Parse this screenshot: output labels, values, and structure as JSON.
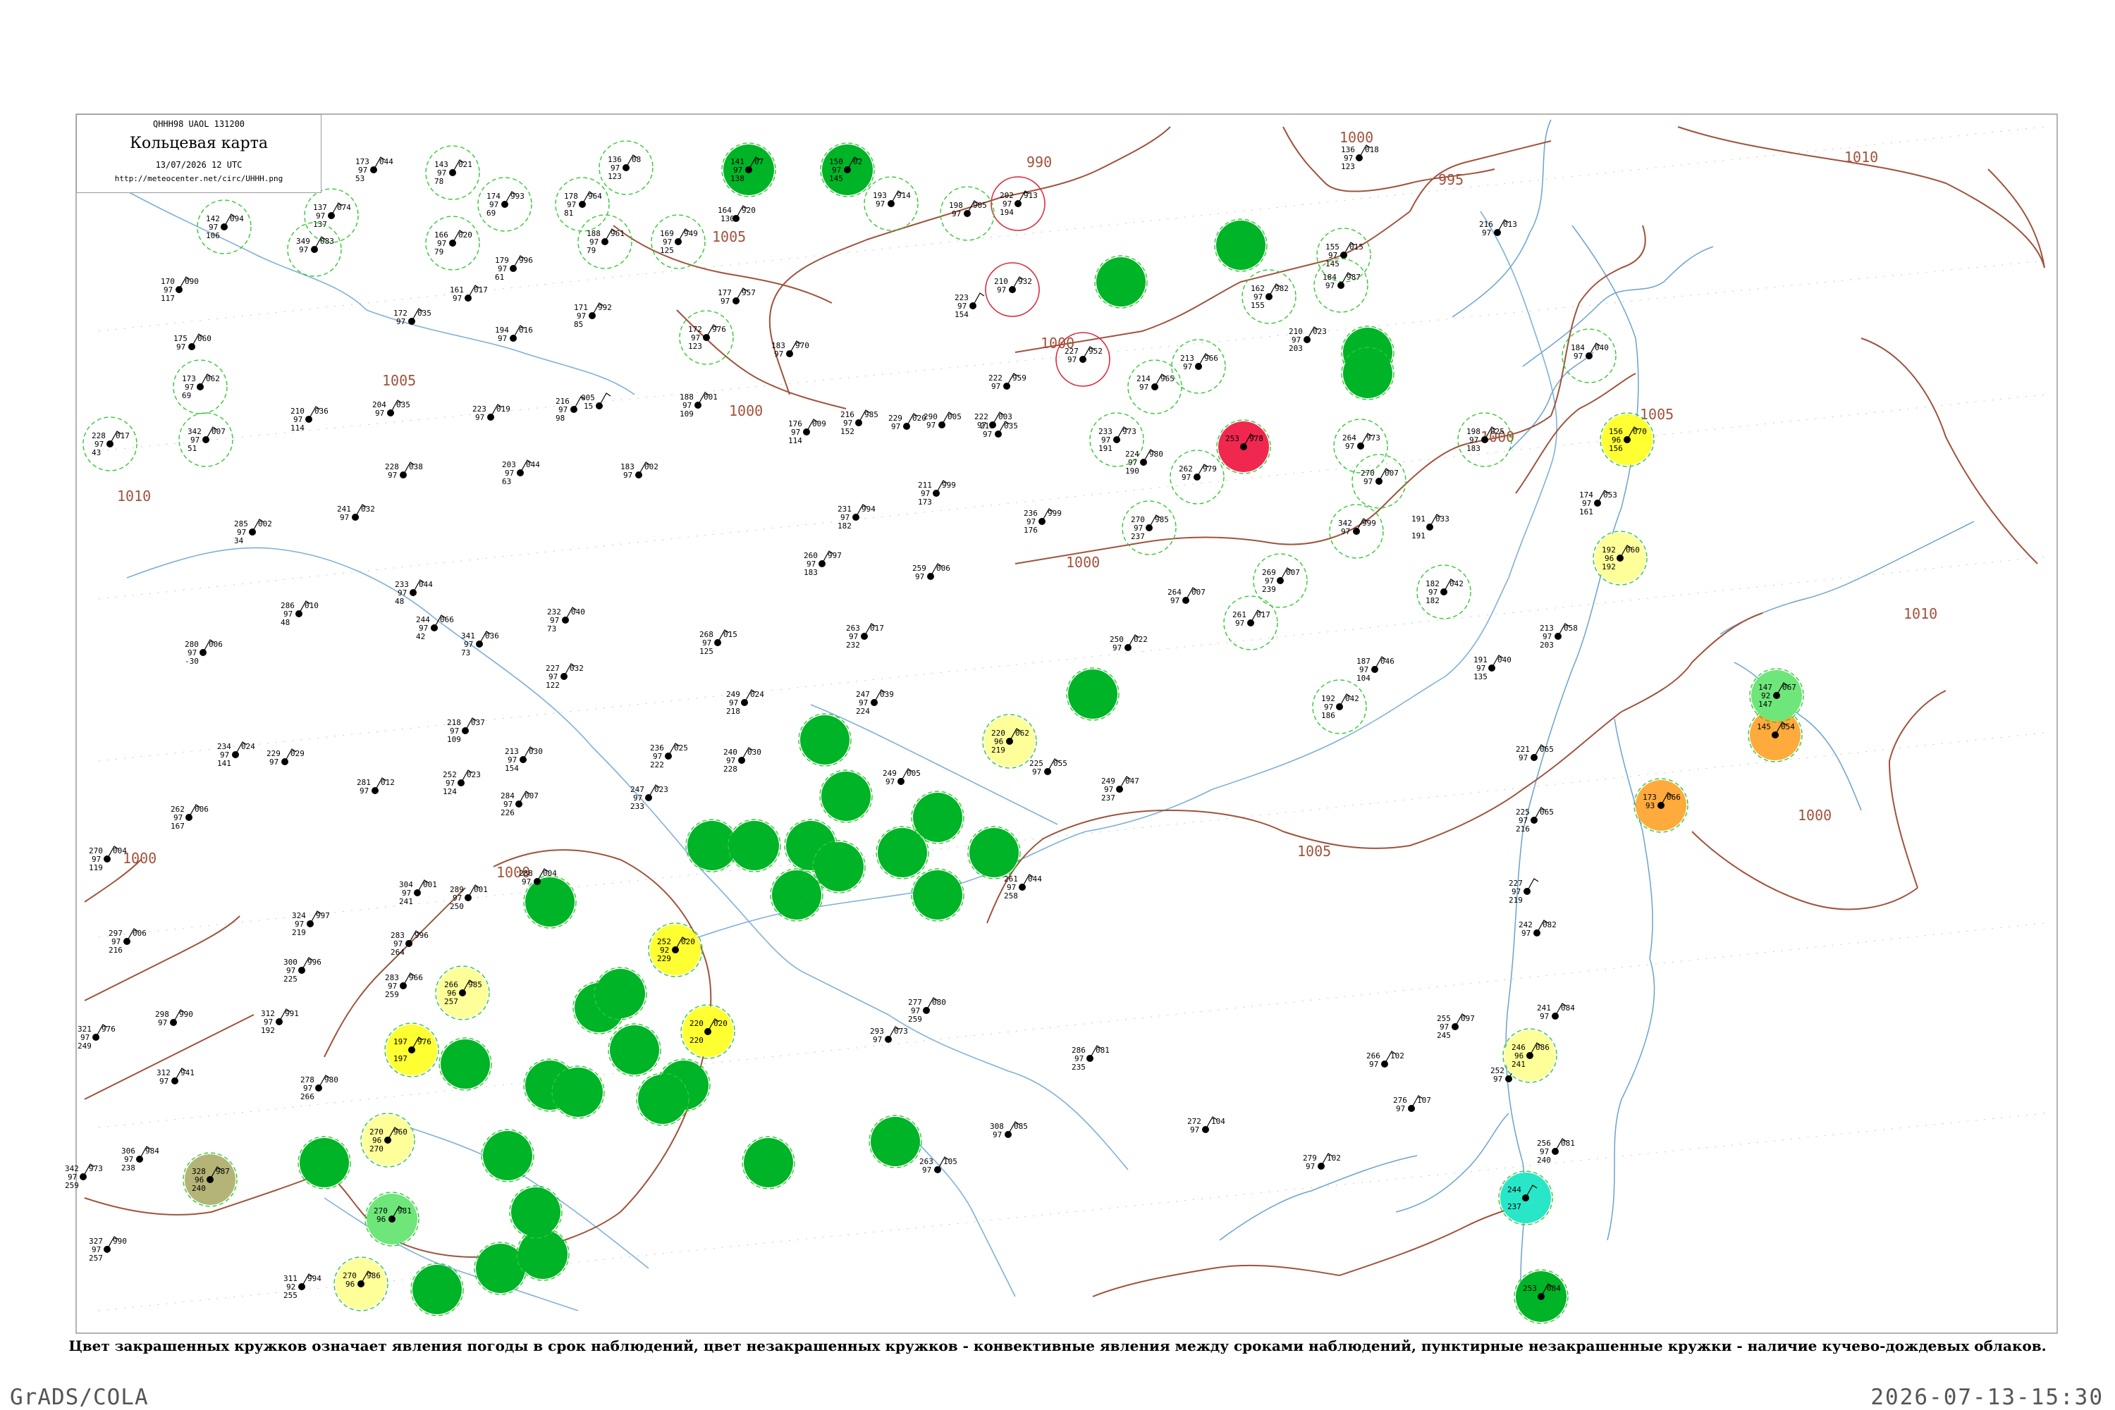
{
  "header": {
    "code": "QHHH98  UAOL  131200",
    "title": "Кольцевая карта",
    "date": "13/07/2026 12 UTC",
    "url": "http://meteocenter.net/circ/UHHH.png"
  },
  "isobars": [
    "1010",
    "1000",
    "995",
    "990",
    "1005",
    "1000",
    "1005",
    "1000",
    "1000",
    "1005",
    "1010",
    "1000",
    "1010",
    "1010",
    "1000",
    "1000",
    "1005",
    "1000"
  ],
  "colors": {
    "isobar": "#a0523c",
    "river": "#7fb0d8",
    "coast": "#6aa2cf",
    "grid": "#c8c8c8",
    "green": "#00b428",
    "light_green": "#6ee67a",
    "yellow": "#ffff32",
    "light_yellow": "#ffff9a",
    "orange": "#ffaa3c",
    "red": "#f02850",
    "olive": "#b4b478",
    "cyan": "#28e6c8",
    "dash_ring": "#32c832",
    "red_ring": "#dc283c"
  },
  "stations": [
    {
      "id": "33",
      "a": "",
      "b": "",
      "c": "",
      "d": ""
    },
    {
      "id": "34",
      "a": "141",
      "b": "97",
      "c": "138",
      "d": "07"
    },
    {
      "id": "35",
      "a": "150",
      "b": "97",
      "c": "145",
      "d": "02"
    },
    {
      "id": "36",
      "a": "136",
      "b": "97",
      "c": "123",
      "d": "08"
    },
    {
      "id": "37",
      "a": "173",
      "b": "97",
      "c": "53",
      "d": "044"
    },
    {
      "id": "38",
      "a": "143",
      "b": "97",
      "c": "78",
      "d": "021"
    },
    {
      "id": "39",
      "a": "137",
      "b": "97",
      "c": "137",
      "d": "074"
    },
    {
      "id": "40",
      "a": "142",
      "b": "97",
      "c": "106",
      "d": "094"
    },
    {
      "id": "41",
      "a": "178",
      "b": "97",
      "c": "81",
      "d": "964"
    },
    {
      "id": "42",
      "a": "174",
      "b": "97",
      "c": "69",
      "d": "993"
    },
    {
      "id": "43",
      "a": "166",
      "b": "97",
      "c": "79",
      "d": "020"
    },
    {
      "id": "44",
      "a": "188",
      "b": "97",
      "c": "79",
      "d": "961"
    },
    {
      "id": "45",
      "a": "169",
      "b": "97",
      "c": "125",
      "d": "949"
    },
    {
      "id": "46",
      "a": "349",
      "b": "97",
      "c": "",
      "d": "083"
    },
    {
      "id": "47",
      "a": "170",
      "b": "97",
      "c": "117",
      "d": "090"
    },
    {
      "id": "48",
      "a": "179",
      "b": "97",
      "c": "61",
      "d": "996"
    },
    {
      "id": "49",
      "a": "161",
      "b": "97",
      "c": "",
      "d": "017"
    },
    {
      "id": "50",
      "a": "171",
      "b": "97",
      "c": "85",
      "d": "992"
    },
    {
      "id": "51",
      "a": "177",
      "b": "97",
      "c": "",
      "d": "957"
    },
    {
      "id": "52",
      "a": "172",
      "b": "97",
      "c": "123",
      "d": "976"
    },
    {
      "id": "53",
      "a": "194",
      "b": "97",
      "c": "",
      "d": "016"
    },
    {
      "id": "54",
      "a": "172",
      "b": "97",
      "c": "",
      "d": "035"
    },
    {
      "id": "55",
      "a": "175",
      "b": "97",
      "c": "",
      "d": "060"
    },
    {
      "id": "56",
      "a": "173",
      "b": "97",
      "c": "69",
      "d": "062"
    },
    {
      "id": "57",
      "a": "183",
      "b": "97",
      "c": "",
      "d": "970"
    },
    {
      "id": "58",
      "a": "223",
      "b": "97",
      "c": "",
      "d": "019"
    },
    {
      "id": "59",
      "a": "204",
      "b": "97",
      "c": "",
      "d": "035"
    },
    {
      "id": "60",
      "a": "216",
      "b": "97",
      "c": "98",
      "d": ""
    },
    {
      "id": "61",
      "a": "005",
      "b": "15",
      "c": "",
      "d": ""
    },
    {
      "id": "62",
      "a": "188",
      "b": "97",
      "c": "109",
      "d": "001"
    },
    {
      "id": "63",
      "a": "210",
      "b": "97",
      "c": "114",
      "d": "036"
    },
    {
      "id": "64",
      "a": "228",
      "b": "97",
      "c": "43",
      "d": "017"
    },
    {
      "id": "65",
      "a": "342",
      "b": "97",
      "c": "51",
      "d": "007"
    },
    {
      "id": "66",
      "a": "228",
      "b": "97",
      "c": "",
      "d": "038"
    },
    {
      "id": "67",
      "a": "203",
      "b": "97",
      "c": "63",
      "d": "044"
    },
    {
      "id": "68",
      "a": "183",
      "b": "97",
      "c": "",
      "d": "002"
    },
    {
      "id": "69",
      "a": "241",
      "b": "97",
      "c": "",
      "d": "032"
    },
    {
      "id": "70",
      "a": "285",
      "b": "97",
      "c": "34",
      "d": "002"
    },
    {
      "id": "71",
      "a": "233",
      "b": "97",
      "c": "48",
      "d": "044"
    },
    {
      "id": "72",
      "a": "286",
      "b": "97",
      "c": "48",
      "d": "010"
    },
    {
      "id": "73",
      "a": "244",
      "b": "97",
      "c": "42",
      "d": "066"
    },
    {
      "id": "74",
      "a": "232",
      "b": "97",
      "c": "73",
      "d": "040"
    },
    {
      "id": "75",
      "a": "280",
      "b": "97",
      "c": "-30",
      "d": "006"
    },
    {
      "id": "76",
      "a": "341",
      "b": "97",
      "c": "73",
      "d": "036"
    },
    {
      "id": "77",
      "a": "227",
      "b": "97",
      "c": "122",
      "d": "032"
    },
    {
      "id": "78",
      "a": "268",
      "b": "97",
      "c": "125",
      "d": "015"
    },
    {
      "id": "79",
      "a": "249",
      "b": "97",
      "c": "218",
      "d": "024"
    },
    {
      "id": "80",
      "a": "247",
      "b": "97",
      "c": "224",
      "d": "039"
    },
    {
      "id": "81",
      "a": "263",
      "b": "97",
      "c": "232",
      "d": "017"
    },
    {
      "id": "82",
      "a": "259",
      "b": "97",
      "c": "",
      "d": "006"
    },
    {
      "id": "83",
      "a": "260",
      "b": "97",
      "c": "183",
      "d": "997"
    },
    {
      "id": "84",
      "a": "231",
      "b": "97",
      "c": "182",
      "d": "994"
    },
    {
      "id": "85",
      "a": "211",
      "b": "97",
      "c": "173",
      "d": "999"
    },
    {
      "id": "86",
      "a": "236",
      "b": "97",
      "c": "176",
      "d": "999"
    },
    {
      "id": "87",
      "a": "264",
      "b": "97",
      "c": "",
      "d": "007"
    },
    {
      "id": "88",
      "a": "261",
      "b": "97",
      "c": "",
      "d": "017"
    },
    {
      "id": "89",
      "a": "250",
      "b": "97",
      "c": "",
      "d": "022"
    },
    {
      "id": "90",
      "a": "216",
      "b": "97",
      "c": "152",
      "d": "985"
    },
    {
      "id": "91",
      "a": "176",
      "b": "97",
      "c": "114",
      "d": "009"
    },
    {
      "id": "92",
      "a": "229",
      "b": "97",
      "c": "",
      "d": "020"
    },
    {
      "id": "93",
      "a": "216",
      "b": "97",
      "c": "",
      "d": "035"
    },
    {
      "id": "94",
      "a": "218",
      "b": "97",
      "c": "109",
      "d": "037"
    },
    {
      "id": "95",
      "a": "234",
      "b": "97",
      "c": "141",
      "d": "024"
    },
    {
      "id": "96",
      "a": "229",
      "b": "97",
      "c": "",
      "d": "029"
    },
    {
      "id": "97",
      "a": "262",
      "b": "97",
      "c": "167",
      "d": "006"
    },
    {
      "id": "98",
      "a": "270",
      "b": "97",
      "c": "119",
      "d": "004"
    },
    {
      "id": "99",
      "a": "281",
      "b": "97",
      "c": "",
      "d": "012"
    },
    {
      "id": "100",
      "a": "213",
      "b": "97",
      "c": "154",
      "d": "030"
    },
    {
      "id": "101",
      "a": "252",
      "b": "97",
      "c": "124",
      "d": "023"
    },
    {
      "id": "102",
      "a": "284",
      "b": "97",
      "c": "226",
      "d": "007"
    },
    {
      "id": "103",
      "a": "236",
      "b": "97",
      "c": "222",
      "d": "025"
    },
    {
      "id": "104",
      "a": "240",
      "b": "97",
      "c": "228",
      "d": "030"
    },
    {
      "id": "105",
      "a": "247",
      "b": "97",
      "c": "233",
      "d": "023"
    },
    {
      "id": "106",
      "a": "249",
      "b": "97",
      "c": "",
      "d": "005"
    },
    {
      "id": "107",
      "a": "288",
      "b": "97",
      "c": "",
      "d": "004"
    },
    {
      "id": "108",
      "a": "304",
      "b": "97",
      "c": "241",
      "d": "001"
    },
    {
      "id": "109",
      "a": "289",
      "b": "97",
      "c": "250",
      "d": "001"
    },
    {
      "id": "110",
      "a": "324",
      "b": "97",
      "c": "219",
      "d": "997"
    },
    {
      "id": "111",
      "a": "283",
      "b": "97",
      "c": "264",
      "d": "996"
    },
    {
      "id": "112",
      "a": "300",
      "b": "97",
      "c": "225",
      "d": "996"
    },
    {
      "id": "113",
      "a": "283",
      "b": "97",
      "c": "259",
      "d": "966"
    },
    {
      "id": "114",
      "a": "297",
      "b": "97",
      "c": "216",
      "d": "006"
    },
    {
      "id": "115",
      "a": "298",
      "b": "97",
      "c": "",
      "d": "990"
    },
    {
      "id": "116",
      "a": "312",
      "b": "97",
      "c": "192",
      "d": "991"
    },
    {
      "id": "117",
      "a": "321",
      "b": "97",
      "c": "249",
      "d": "976"
    },
    {
      "id": "118",
      "a": "312",
      "b": "97",
      "c": "",
      "d": "941"
    },
    {
      "id": "119",
      "a": "306",
      "b": "97",
      "c": "238",
      "d": "984"
    },
    {
      "id": "120",
      "a": "342",
      "b": "97",
      "c": "259",
      "d": "973"
    },
    {
      "id": "121",
      "a": "327",
      "b": "97",
      "c": "257",
      "d": "990"
    },
    {
      "id": "122",
      "a": "311",
      "b": "92",
      "c": "255",
      "d": "994"
    },
    {
      "id": "123",
      "a": "278",
      "b": "97",
      "c": "266",
      "d": "980"
    },
    {
      "id": "124",
      "a": "277",
      "b": "97",
      "c": "259",
      "d": "080"
    },
    {
      "id": "125",
      "a": "293",
      "b": "97",
      "c": "",
      "d": "073"
    },
    {
      "id": "126",
      "a": "286",
      "b": "97",
      "c": "235",
      "d": "081"
    },
    {
      "id": "127",
      "a": "308",
      "b": "97",
      "c": "",
      "d": "085"
    },
    {
      "id": "128",
      "a": "263",
      "b": "97",
      "c": "",
      "d": "105"
    },
    {
      "id": "129",
      "a": "272",
      "b": "97",
      "c": "",
      "d": "104"
    },
    {
      "id": "130",
      "a": "279",
      "b": "97",
      "c": "",
      "d": "102"
    },
    {
      "id": "131",
      "a": "266",
      "b": "97",
      "c": "",
      "d": "102"
    },
    {
      "id": "132",
      "a": "276",
      "b": "97",
      "c": "",
      "d": "107"
    },
    {
      "id": "133",
      "a": "255",
      "b": "97",
      "c": "245",
      "d": "097"
    },
    {
      "id": "134",
      "a": "252",
      "b": "97",
      "c": "",
      "d": "077"
    },
    {
      "id": "135",
      "a": "256",
      "b": "97",
      "c": "240",
      "d": "081"
    },
    {
      "id": "136",
      "a": "241",
      "b": "97",
      "c": "",
      "d": "084"
    },
    {
      "id": "137",
      "a": "227",
      "b": "97",
      "c": "219",
      "d": ""
    },
    {
      "id": "138",
      "a": "242",
      "b": "97",
      "c": "",
      "d": "082"
    },
    {
      "id": "139",
      "a": "221",
      "b": "97",
      "c": "",
      "d": "065"
    },
    {
      "id": "140",
      "a": "225",
      "b": "97",
      "c": "216",
      "d": "065"
    },
    {
      "id": "141",
      "a": "213",
      "b": "97",
      "c": "203",
      "d": "058"
    },
    {
      "id": "142",
      "a": "191",
      "b": "97",
      "c": "135",
      "d": "040"
    },
    {
      "id": "143",
      "a": "187",
      "b": "97",
      "c": "104",
      "d": "046"
    },
    {
      "id": "144",
      "a": "192",
      "b": "97",
      "c": "186",
      "d": "042"
    },
    {
      "id": "145",
      "a": "182",
      "b": "97",
      "c": "182",
      "d": "042"
    },
    {
      "id": "146",
      "a": "191",
      "b": "",
      "c": "191",
      "d": "033"
    },
    {
      "id": "147",
      "a": "174",
      "b": "97",
      "c": "161",
      "d": "053"
    },
    {
      "id": "148",
      "a": "184",
      "b": "97",
      "c": "",
      "d": "040"
    },
    {
      "id": "149",
      "a": "198",
      "b": "97",
      "c": "183",
      "d": "025"
    },
    {
      "id": "150",
      "a": "216",
      "b": "97",
      "c": "",
      "d": "013"
    },
    {
      "id": "151",
      "a": "136",
      "b": "97",
      "c": "123",
      "d": "018"
    },
    {
      "id": "152",
      "a": "155",
      "b": "97",
      "c": "145",
      "d": "015"
    },
    {
      "id": "153",
      "a": "162",
      "b": "97",
      "c": "155",
      "d": "982"
    },
    {
      "id": "154",
      "a": "210",
      "b": "97",
      "c": "203",
      "d": "023"
    },
    {
      "id": "155",
      "a": "184",
      "b": "97",
      "c": "",
      "d": "987"
    },
    {
      "id": "156",
      "a": "264",
      "b": "97",
      "c": "",
      "d": "973"
    },
    {
      "id": "157",
      "a": "270",
      "b": "97",
      "c": "",
      "d": "007"
    },
    {
      "id": "158",
      "a": "342",
      "b": "97",
      "c": "",
      "d": "999"
    },
    {
      "id": "159",
      "a": "269",
      "b": "97",
      "c": "239",
      "d": "007"
    },
    {
      "id": "160",
      "a": "262",
      "b": "97",
      "c": "",
      "d": "979"
    },
    {
      "id": "161",
      "a": "213",
      "b": "97",
      "c": "",
      "d": "966"
    },
    {
      "id": "162",
      "a": "214",
      "b": "97",
      "c": "",
      "d": "965"
    },
    {
      "id": "163",
      "a": "233",
      "b": "97",
      "c": "191",
      "d": "973"
    },
    {
      "id": "164",
      "a": "224",
      "b": "97",
      "c": "190",
      "d": "980"
    },
    {
      "id": "165",
      "a": "270",
      "b": "97",
      "c": "237",
      "d": "985"
    },
    {
      "id": "166",
      "a": "227",
      "b": "97",
      "c": "",
      "d": "952"
    },
    {
      "id": "167",
      "a": "222",
      "b": "97",
      "c": "",
      "d": "959"
    },
    {
      "id": "168",
      "a": "210",
      "b": "97",
      "c": "",
      "d": "932"
    },
    {
      "id": "169",
      "a": "202",
      "b": "97",
      "c": "194",
      "d": "913"
    },
    {
      "id": "170",
      "a": "198",
      "b": "97",
      "c": "",
      "d": "905"
    },
    {
      "id": "171",
      "a": "193",
      "b": "97",
      "c": "",
      "d": "914"
    },
    {
      "id": "172",
      "a": "223",
      "b": "97",
      "c": "154",
      "d": ""
    },
    {
      "id": "173",
      "a": "164",
      "b": "130",
      "c": "",
      "d": "920"
    },
    {
      "id": "174",
      "a": "222",
      "b": "97",
      "c": "",
      "d": "003"
    },
    {
      "id": "175",
      "a": "290",
      "b": "97",
      "c": "",
      "d": "005"
    },
    {
      "id": "176",
      "a": "220",
      "b": "96",
      "c": "219",
      "d": "062"
    },
    {
      "id": "177",
      "a": "225",
      "b": "97",
      "c": "",
      "d": "055"
    },
    {
      "id": "178",
      "a": "249",
      "b": "97",
      "c": "237",
      "d": "047"
    },
    {
      "id": "179",
      "a": "261",
      "b": "97",
      "c": "258",
      "d": "044"
    },
    {
      "id": "180",
      "a": "252",
      "b": "92",
      "c": "229",
      "d": "020"
    },
    {
      "id": "181",
      "a": "220",
      "b": "",
      "c": "220",
      "d": "020"
    },
    {
      "id": "182",
      "a": "197",
      "b": "",
      "c": "197",
      "d": "976"
    },
    {
      "id": "183",
      "a": "266",
      "b": "96",
      "c": "257",
      "d": "985"
    },
    {
      "id": "184",
      "a": "270",
      "b": "96",
      "c": "270",
      "d": "960"
    },
    {
      "id": "185",
      "a": "328",
      "b": "96",
      "c": "240",
      "d": "987"
    },
    {
      "id": "186",
      "a": "270",
      "b": "96",
      "c": "",
      "d": "981"
    },
    {
      "id": "187",
      "a": "270",
      "b": "96",
      "c": "",
      "d": "986"
    },
    {
      "id": "188",
      "a": "246",
      "b": "96",
      "c": "241",
      "d": "086"
    },
    {
      "id": "189",
      "a": "156",
      "b": "96",
      "c": "156",
      "d": "070"
    },
    {
      "id": "190",
      "a": "192",
      "b": "96",
      "c": "192",
      "d": "060"
    },
    {
      "id": "191",
      "a": "173",
      "b": "93",
      "c": "",
      "d": "066"
    },
    {
      "id": "192",
      "a": "145",
      "b": "",
      "c": "",
      "d": "054"
    },
    {
      "id": "193",
      "a": "147",
      "b": "92",
      "c": "147",
      "d": "067"
    },
    {
      "id": "194",
      "a": "244",
      "b": "",
      "c": "237",
      "d": ""
    },
    {
      "id": "195",
      "a": "253",
      "b": "",
      "c": "",
      "d": "084"
    },
    {
      "id": "196",
      "a": "253",
      "b": "",
      "c": "",
      "d": "978"
    }
  ],
  "caption": "Цвет закрашенных кружков означает явления погоды в срок наблюдений, цвет незакрашенных кружков - конвективные явления между сроками наблюдений, пунктирные незакрашенные кружки - наличие кучево-дождевых облаков.",
  "footer": {
    "left": "GrADS/COLA",
    "right": "2026-07-13-15:30"
  }
}
